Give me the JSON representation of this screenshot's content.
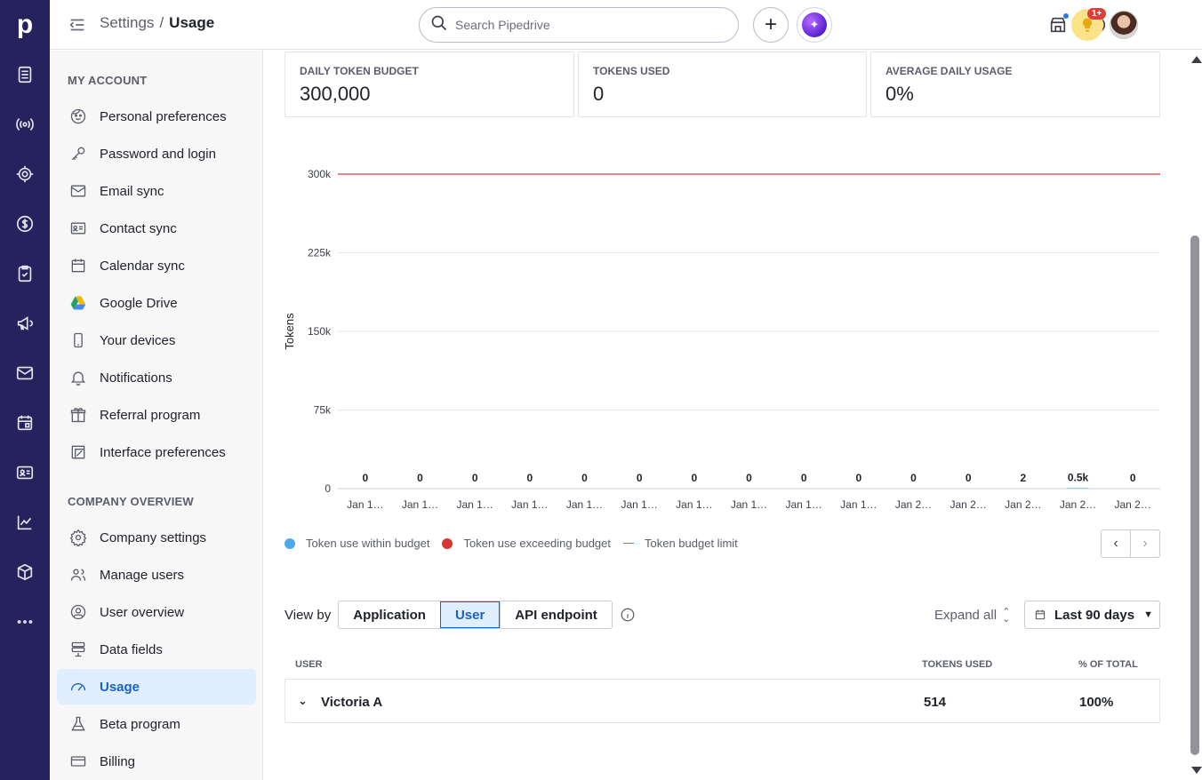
{
  "rail": {
    "logo": "p",
    "items": [
      "activity-list-icon",
      "broadcast-icon",
      "target-icon",
      "dollar-icon",
      "checklist-icon",
      "megaphone-icon",
      "mail-icon",
      "calendar-icon",
      "contacts-card-icon",
      "chart-icon",
      "box-icon",
      "more-icon"
    ]
  },
  "header": {
    "breadcrumb_parent": "Settings",
    "breadcrumb_sep": "/",
    "breadcrumb_current": "Usage",
    "search_placeholder": "Search Pipedrive",
    "plus_label": "+",
    "ai_label": "✦",
    "tips_badge": "1+"
  },
  "sidebar": {
    "my_account_title": "MY ACCOUNT",
    "my_account": [
      {
        "label": "Personal preferences",
        "icon": "face-icon"
      },
      {
        "label": "Password and login",
        "icon": "key-icon"
      },
      {
        "label": "Email sync",
        "icon": "mail-icon"
      },
      {
        "label": "Contact sync",
        "icon": "contact-card-icon"
      },
      {
        "label": "Calendar sync",
        "icon": "calendar-icon"
      },
      {
        "label": "Google Drive",
        "icon": "google-drive-icon"
      },
      {
        "label": "Your devices",
        "icon": "phone-icon"
      },
      {
        "label": "Notifications",
        "icon": "bell-icon"
      },
      {
        "label": "Referral program",
        "icon": "gift-icon"
      },
      {
        "label": "Interface preferences",
        "icon": "interface-icon"
      }
    ],
    "company_title": "COMPANY OVERVIEW",
    "company": [
      {
        "label": "Company settings",
        "icon": "gear-icon"
      },
      {
        "label": "Manage users",
        "icon": "users-icon"
      },
      {
        "label": "User overview",
        "icon": "user-circle-icon"
      },
      {
        "label": "Data fields",
        "icon": "data-fields-icon"
      },
      {
        "label": "Usage",
        "icon": "gauge-icon",
        "active": true
      },
      {
        "label": "Beta program",
        "icon": "flask-icon"
      },
      {
        "label": "Billing",
        "icon": "credit-card-icon"
      }
    ]
  },
  "stats": [
    {
      "label": "DAILY TOKEN BUDGET",
      "value": "300,000"
    },
    {
      "label": "TOKENS USED",
      "value": "0"
    },
    {
      "label": "AVERAGE DAILY USAGE",
      "value": "0%"
    }
  ],
  "chart_data": {
    "type": "bar",
    "ylabel": "Tokens",
    "yticks": [
      "0",
      "75k",
      "150k",
      "225k",
      "300k"
    ],
    "ylim": [
      0,
      300000
    ],
    "budget_limit": 300000,
    "categories": [
      "Jan 1…",
      "Jan 1…",
      "Jan 1…",
      "Jan 1…",
      "Jan 1…",
      "Jan 1…",
      "Jan 1…",
      "Jan 1…",
      "Jan 1…",
      "Jan 1…",
      "Jan 2…",
      "Jan 2…",
      "Jan 2…",
      "Jan 2…",
      "Jan 2…"
    ],
    "data_labels": [
      "0",
      "0",
      "0",
      "0",
      "0",
      "0",
      "0",
      "0",
      "0",
      "0",
      "0",
      "0",
      "2",
      "0.5k",
      "0"
    ],
    "values": [
      0,
      0,
      0,
      0,
      0,
      0,
      0,
      0,
      0,
      0,
      0,
      0,
      2,
      500,
      0
    ],
    "legend": [
      "Token use within budget",
      "Token use exceeding budget",
      "Token budget limit"
    ],
    "colors": {
      "within": "#4ea9e8",
      "exceeding": "#d93434",
      "limit": "#e05a5a",
      "grid": "#e8e9ec"
    }
  },
  "viewby": {
    "label": "View by",
    "options": [
      "Application",
      "User",
      "API endpoint"
    ],
    "selected": "User",
    "expand_all": "Expand all",
    "range": "Last 90 days"
  },
  "table": {
    "headers": {
      "user": "USER",
      "tokens": "TOKENS USED",
      "percent": "% OF TOTAL"
    },
    "rows": [
      {
        "user": "Victoria A",
        "tokens": "514",
        "percent": "100%"
      }
    ]
  }
}
